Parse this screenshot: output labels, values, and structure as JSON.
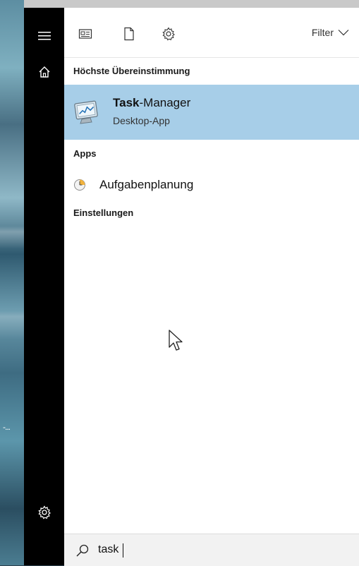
{
  "toolbar": {
    "filter_label": "Filter"
  },
  "sections": {
    "best_match_title": "Höchste Übereinstimmung",
    "apps_title": "Apps",
    "settings_title": "Einstellungen"
  },
  "best_match": {
    "title_bold": "Task",
    "title_rest": "-Manager",
    "subtitle": "Desktop-App"
  },
  "apps": [
    {
      "label": "Aufgabenplanung"
    }
  ],
  "search": {
    "value": "task"
  },
  "wallpaper": {
    "ellipsis": "-..."
  },
  "colors": {
    "rail": "#000000",
    "highlight": "#a7cee8",
    "search_bg": "#f2f2f2"
  },
  "icons": {
    "rail": [
      "hamburger-menu-icon",
      "home-icon",
      "settings-gear-icon"
    ],
    "toolbar": [
      "news-icon",
      "document-icon",
      "settings-gear-icon",
      "chevron-down-icon"
    ],
    "search": "search-icon"
  }
}
